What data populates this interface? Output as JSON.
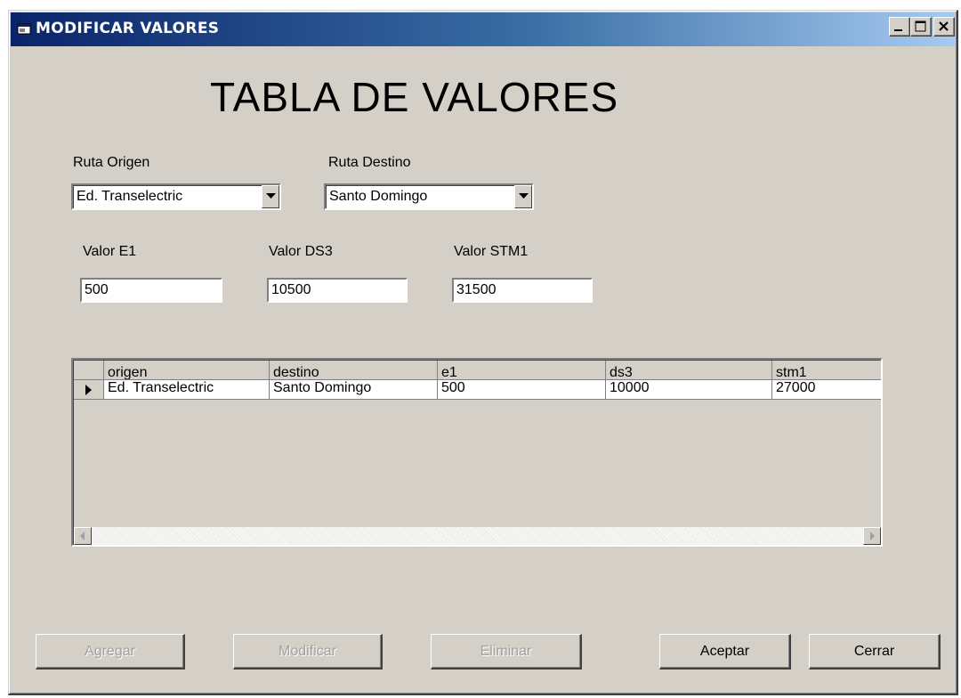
{
  "window": {
    "title": "MODIFICAR VALORES",
    "minimize_label": "_",
    "maximize_label": "□",
    "close_label": "X"
  },
  "heading": "TABLA DE VALORES",
  "route": {
    "origin_label": "Ruta Origen",
    "origin_value": "Ed. Transelectric",
    "destination_label": "Ruta Destino",
    "destination_value": "Santo Domingo"
  },
  "values": {
    "e1_label": "Valor E1",
    "e1_value": "500",
    "ds3_label": "Valor DS3",
    "ds3_value": "10500",
    "stm1_label": "Valor STM1",
    "stm1_value": "31500"
  },
  "grid": {
    "columns": [
      "origen",
      "destino",
      "e1",
      "ds3",
      "stm1"
    ],
    "rows": [
      [
        "Ed. Transelectric",
        "Santo Domingo",
        "500",
        "10000",
        "27000"
      ]
    ]
  },
  "buttons": {
    "add": "Agregar",
    "modify": "Modificar",
    "delete": "Eliminar",
    "accept": "Aceptar",
    "close": "Cerrar"
  },
  "colors": {
    "titlebar_start": "#0a246a",
    "titlebar_end": "#a6caf0",
    "face": "#d4d0c8",
    "disabled_text": "#a0a0a0"
  }
}
